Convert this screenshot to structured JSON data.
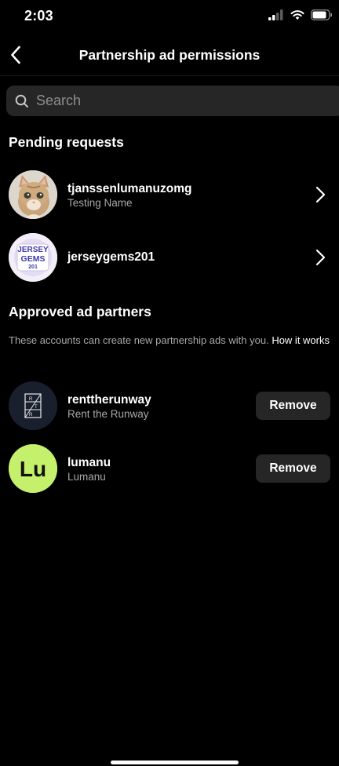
{
  "status_bar": {
    "time": "2:03"
  },
  "nav": {
    "title": "Partnership ad permissions"
  },
  "search": {
    "placeholder": "Search"
  },
  "pending": {
    "title": "Pending requests",
    "items": [
      {
        "username": "tjanssenlumanuzomg",
        "name": "Testing Name"
      },
      {
        "username": "jerseygems201",
        "name": "",
        "avatar_text": [
          "JERSEY",
          "GEMS",
          "201"
        ]
      }
    ]
  },
  "approved": {
    "title": "Approved ad partners",
    "description": "These accounts can create new partnership ads with you.",
    "link": "How it works",
    "remove_label": "Remove",
    "items": [
      {
        "username": "renttherunway",
        "name": "Rent the Runway",
        "avatar_text": [
          "R",
          "T",
          "R"
        ]
      },
      {
        "username": "lumanu",
        "name": "Lumanu",
        "avatar_text": "Lu"
      }
    ]
  },
  "colors": {
    "background": "#000000",
    "surface": "#262626",
    "secondary_text": "#a8a8a8",
    "lumanu_green": "#c4f06b",
    "rtr_navy": "#1a1f2e"
  }
}
